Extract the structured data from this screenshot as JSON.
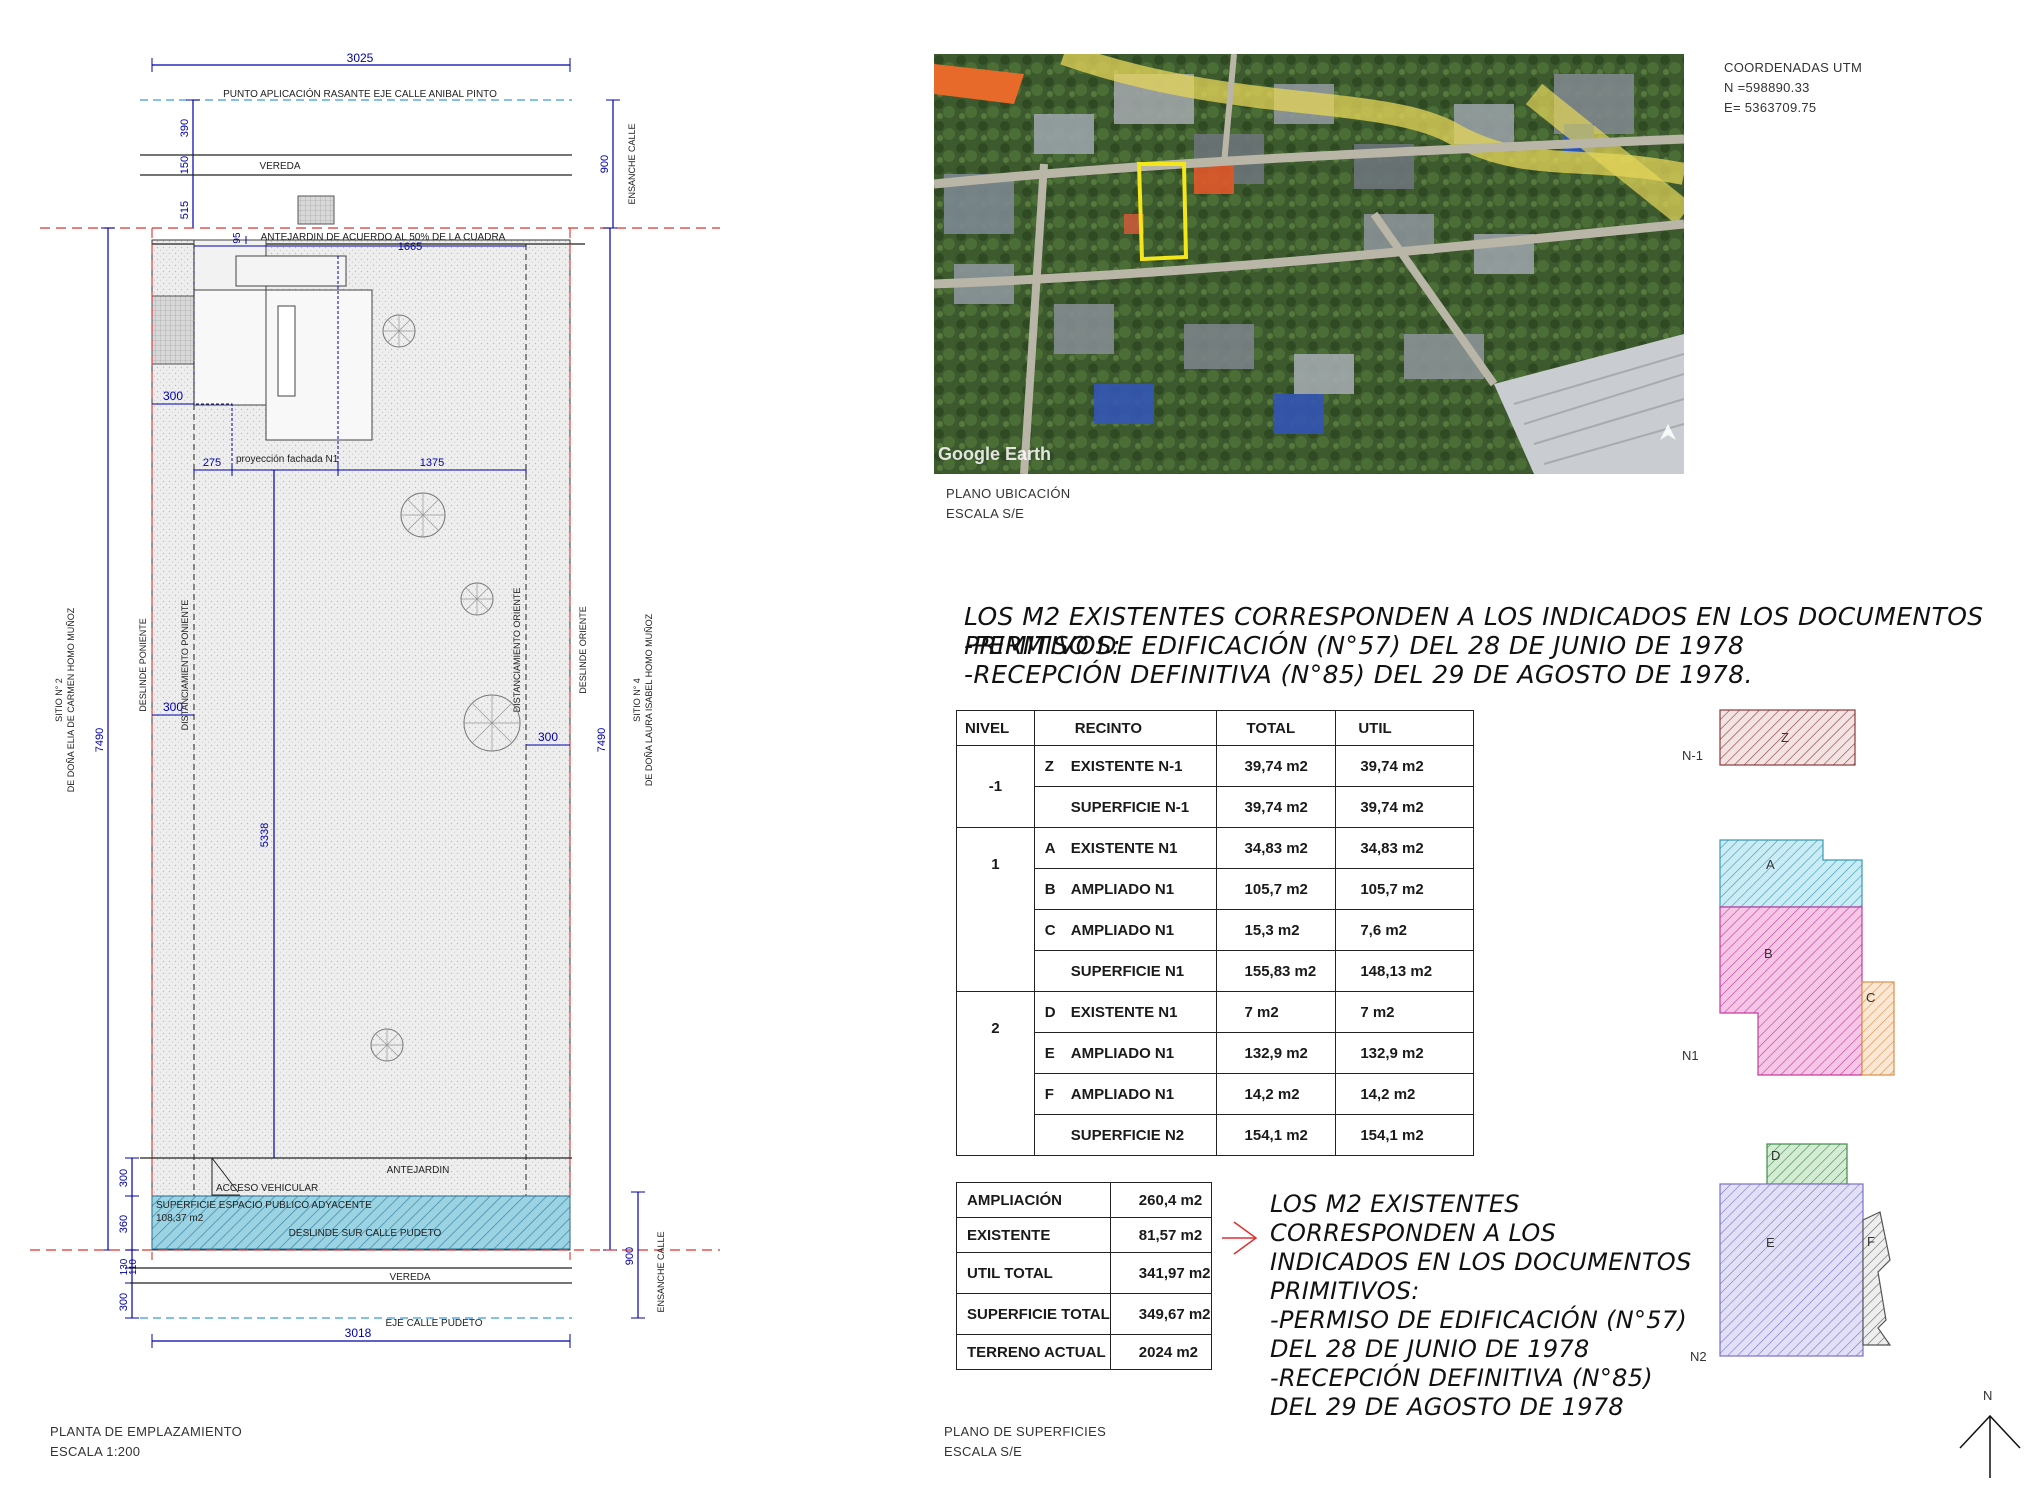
{
  "site_plan": {
    "top_width_dim": "3025",
    "bottom_width_dim": "3018",
    "rasante_label": "PUNTO APLICACIÓN RASANTE EJE CALLE ANIBAL PINTO",
    "dim_390": "390",
    "dim_150": "150",
    "dim_515": "515",
    "dim_900_top": "900",
    "ensanche_top": "ENSANCHE CALLE",
    "vereda_top": "VEREDA",
    "antejardin_top": "ANTEJARDIN DE ACUERDO AL 50% DE LA CUADRA",
    "dim_95": "95",
    "dim_1665": "1665",
    "dim_300_a": "300",
    "dim_275": "275",
    "proyeccion_label": "proyección fachada N1",
    "dim_1375": "1375",
    "deslinde_poniente": "DESLINDE PONIENTE",
    "distanciamiento_poniente": "DISTANCIAMIENTO PONIENTE",
    "distanciamiento_oriente": "DISTANCIAMIENTO ORIENTE",
    "deslinde_oriente": "DESLINDE ORIENTE",
    "sitio_left_1": "SITIO N° 2",
    "sitio_left_2": "DE DOÑA ELIA DE CARMEN HOMO MUÑOZ",
    "sitio_right_1": "SITIO N° 4",
    "sitio_right_2": "DE DOÑA LAURA ISABEL HOMO MUÑOZ",
    "dim_7490_left": "7490",
    "dim_7490_right": "7490",
    "dim_300_b": "300",
    "dim_300_c": "300",
    "dim_5338": "5338",
    "dim_300_d": "300",
    "antejardin_bottom": "ANTEJARDIN",
    "acceso": "ACCESO VEHICULAR",
    "superficie_espacio": "SUPERFICIE ESPACIO PUBLICO ADYACENTE",
    "superficie_valor": "108,37 m2",
    "deslinde_sur": "DESLINDE SUR CALLE PUDETO",
    "dim_360": "360",
    "dim_130": "130",
    "dim_110": "110",
    "vereda_bottom": "VEREDA",
    "dim_300_e": "300",
    "eje_calle": "EJE CALLE PUDETO",
    "dim_900_bottom": "900",
    "ensanche_bottom": "ENSANCHE CALLE",
    "title": "PLANTA DE EMPLAZAMIENTO",
    "scale": "ESCALA 1:200"
  },
  "location": {
    "utm_title": "COORDENADAS UTM",
    "utm_n": "N =598890.33",
    "utm_e": "E= 5363709.75",
    "map_watermark": "Google Earth",
    "title": "PLANO UBICACIÓN",
    "scale": "ESCALA S/E"
  },
  "notes": {
    "line1": "LOS M2 EXISTENTES CORRESPONDEN A LOS INDICADOS EN LOS DOCUMENTOS PRIMITIVOS:",
    "line2": "-PERMISO DE EDIFICACIÓN (N°57) DEL 28 DE JUNIO DE 1978",
    "line3": "-RECEPCIÓN DEFINITIVA (N°85) DEL 29 DE AGOSTO DE 1978.",
    "side_lines": [
      "LOS M2 EXISTENTES",
      "CORRESPONDEN A LOS",
      "INDICADOS EN LOS DOCUMENTOS",
      "PRIMITIVOS:",
      "-PERMISO DE EDIFICACIÓN (N°57)",
      "DEL 28 DE JUNIO DE 1978",
      "-RECEPCIÓN DEFINITIVA (N°85)",
      "DEL 29 DE AGOSTO DE 1978"
    ]
  },
  "surfaces": {
    "headers": [
      "NIVEL",
      "RECINTO",
      "TOTAL",
      "UTIL"
    ],
    "groups": [
      {
        "nivel": "-1",
        "rows": [
          {
            "code": "Z",
            "recinto": "EXISTENTE N-1",
            "total": "39,74 m2",
            "util": "39,74 m2"
          },
          {
            "code": "",
            "recinto": "SUPERFICIE N-1",
            "total": "39,74 m2",
            "util": "39,74 m2"
          }
        ]
      },
      {
        "nivel": "1",
        "rows": [
          {
            "code": "A",
            "recinto": "EXISTENTE N1",
            "total": "34,83 m2",
            "util": "34,83 m2"
          },
          {
            "code": "B",
            "recinto": "AMPLIADO N1",
            "total": "105,7 m2",
            "util": "105,7 m2"
          },
          {
            "code": "C",
            "recinto": "AMPLIADO N1",
            "total": "15,3 m2",
            "util": "7,6 m2"
          },
          {
            "code": "",
            "recinto": "SUPERFICIE N1",
            "total": "155,83 m2",
            "util": "148,13 m2"
          }
        ]
      },
      {
        "nivel": "2",
        "rows": [
          {
            "code": "D",
            "recinto": "EXISTENTE N1",
            "total": "7 m2",
            "util": "7 m2"
          },
          {
            "code": "E",
            "recinto": "AMPLIADO N1",
            "total": "132,9 m2",
            "util": "132,9 m2"
          },
          {
            "code": "F",
            "recinto": "AMPLIADO N1",
            "total": "14,2 m2",
            "util": "14,2 m2"
          },
          {
            "code": "",
            "recinto": "SUPERFICIE N2",
            "total": "154,1 m2",
            "util": "154,1 m2"
          }
        ]
      }
    ],
    "summary": [
      {
        "label": "AMPLIACIÓN",
        "value": "260,4 m2"
      },
      {
        "label": "EXISTENTE",
        "value": "81,57 m2"
      },
      {
        "label": "UTIL TOTAL",
        "value": "341,97 m2"
      },
      {
        "label": "SUPERFICIE TOTAL",
        "value": "349,67 m2"
      },
      {
        "label": "TERRENO ACTUAL",
        "value": "2024 m2"
      }
    ],
    "title": "PLANO DE SUPERFICIES",
    "scale": "ESCALA S/E"
  },
  "diagrams": {
    "n_minus1": "N-1",
    "n1": "N1",
    "n2": "N2",
    "z": "Z",
    "a": "A",
    "b": "B",
    "c": "C",
    "d": "D",
    "e": "E",
    "f": "F",
    "north": "N",
    "colors": {
      "z": "#8b3a3a",
      "a": "#3a9ab5",
      "b": "#c23c9c",
      "c": "#d9904a",
      "d": "#3f8a4a",
      "e": "#7a72c8",
      "f": "#666666"
    }
  }
}
